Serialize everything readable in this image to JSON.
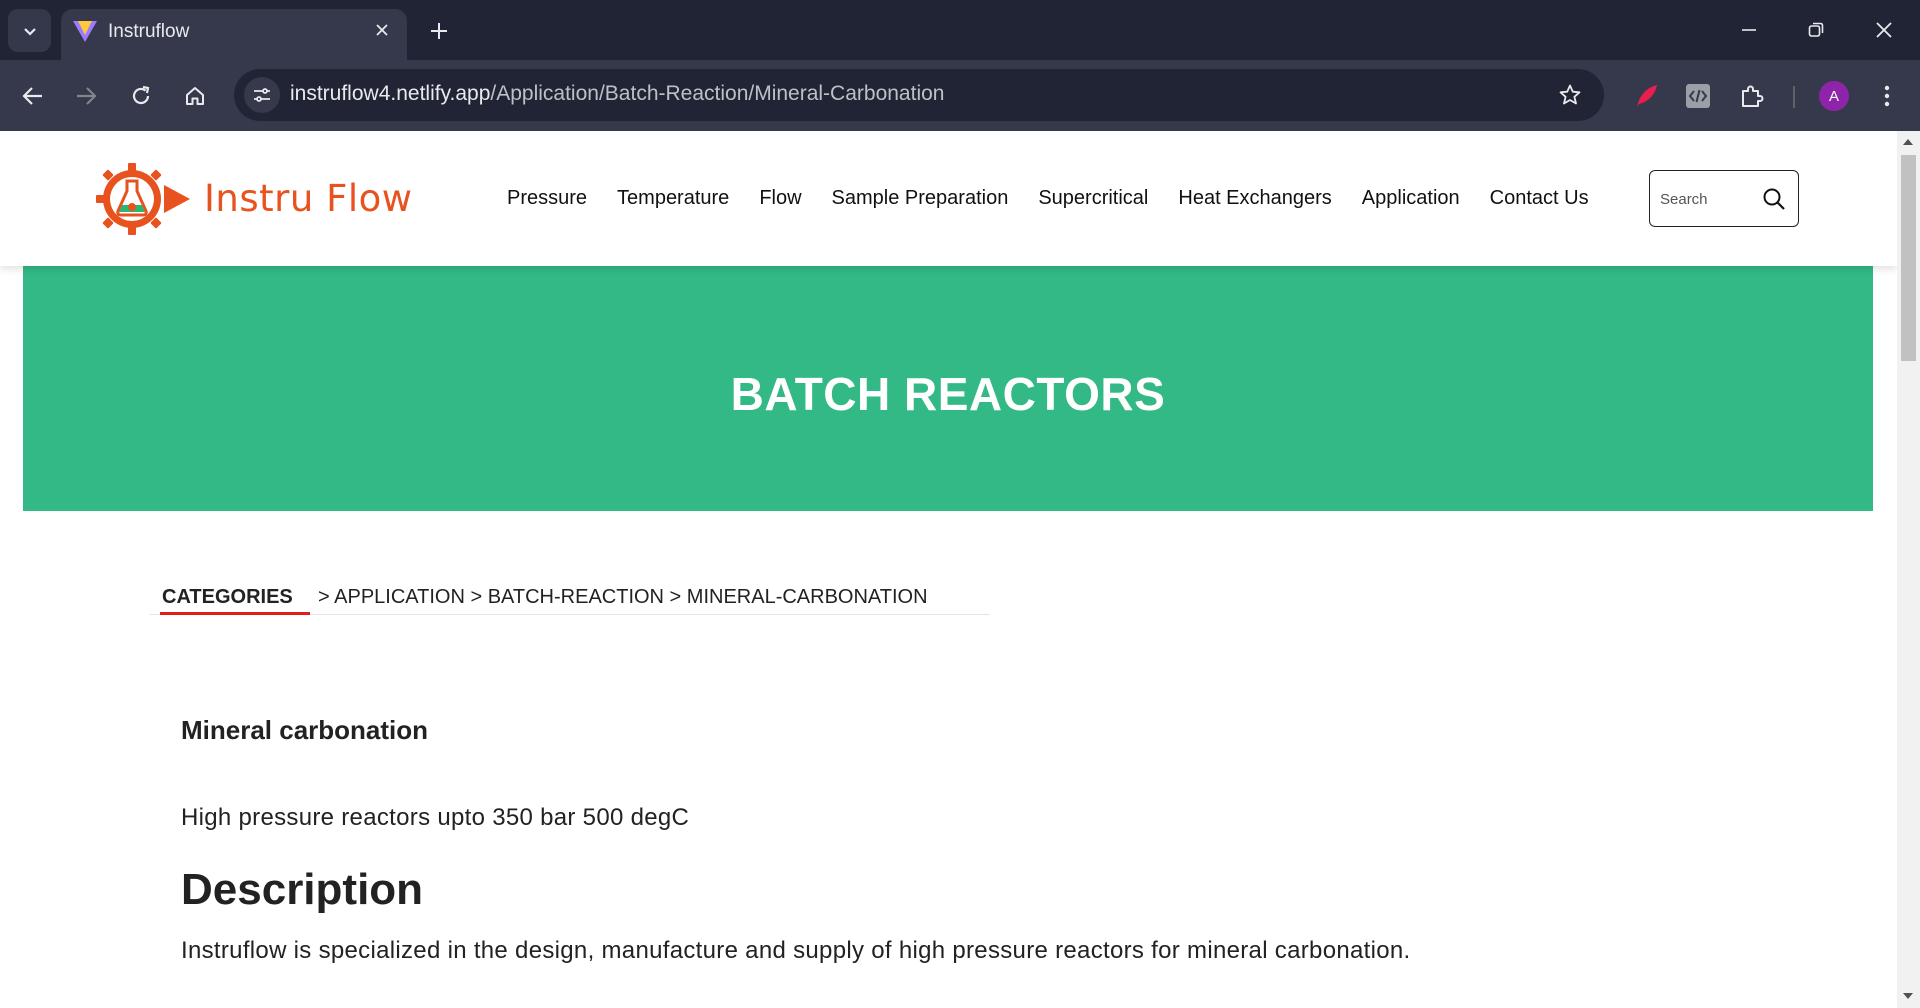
{
  "browser": {
    "tab_title": "Instruflow",
    "url_host": "instruflow4.netlify.app",
    "url_path": "/Application/Batch-Reaction/Mineral-Carbonation",
    "avatar_letter": "A"
  },
  "header": {
    "logo_text": "Instru Flow",
    "menu": [
      "Pressure",
      "Temperature",
      "Flow",
      "Sample Preparation",
      "Supercritical",
      "Heat Exchangers",
      "Application",
      "Contact Us"
    ],
    "search_placeholder": "Search"
  },
  "hero": {
    "title": "BATCH REACTORS"
  },
  "breadcrumb": {
    "categories_label": "CATEGORIES",
    "path": "> APPLICATION > BATCH-REACTION > MINERAL-CARBONATION"
  },
  "product": {
    "title": "Mineral carbonation",
    "subtitle": "High pressure reactors upto 350 bar 500 degC",
    "description_heading": "Description",
    "description_text": "Instruflow is specialized in the design, manufacture and supply of high pressure reactors for mineral carbonation."
  },
  "colors": {
    "hero_green": "#32b985",
    "logo_orange": "#e8521f",
    "crumb_underline": "#e21b1b"
  }
}
